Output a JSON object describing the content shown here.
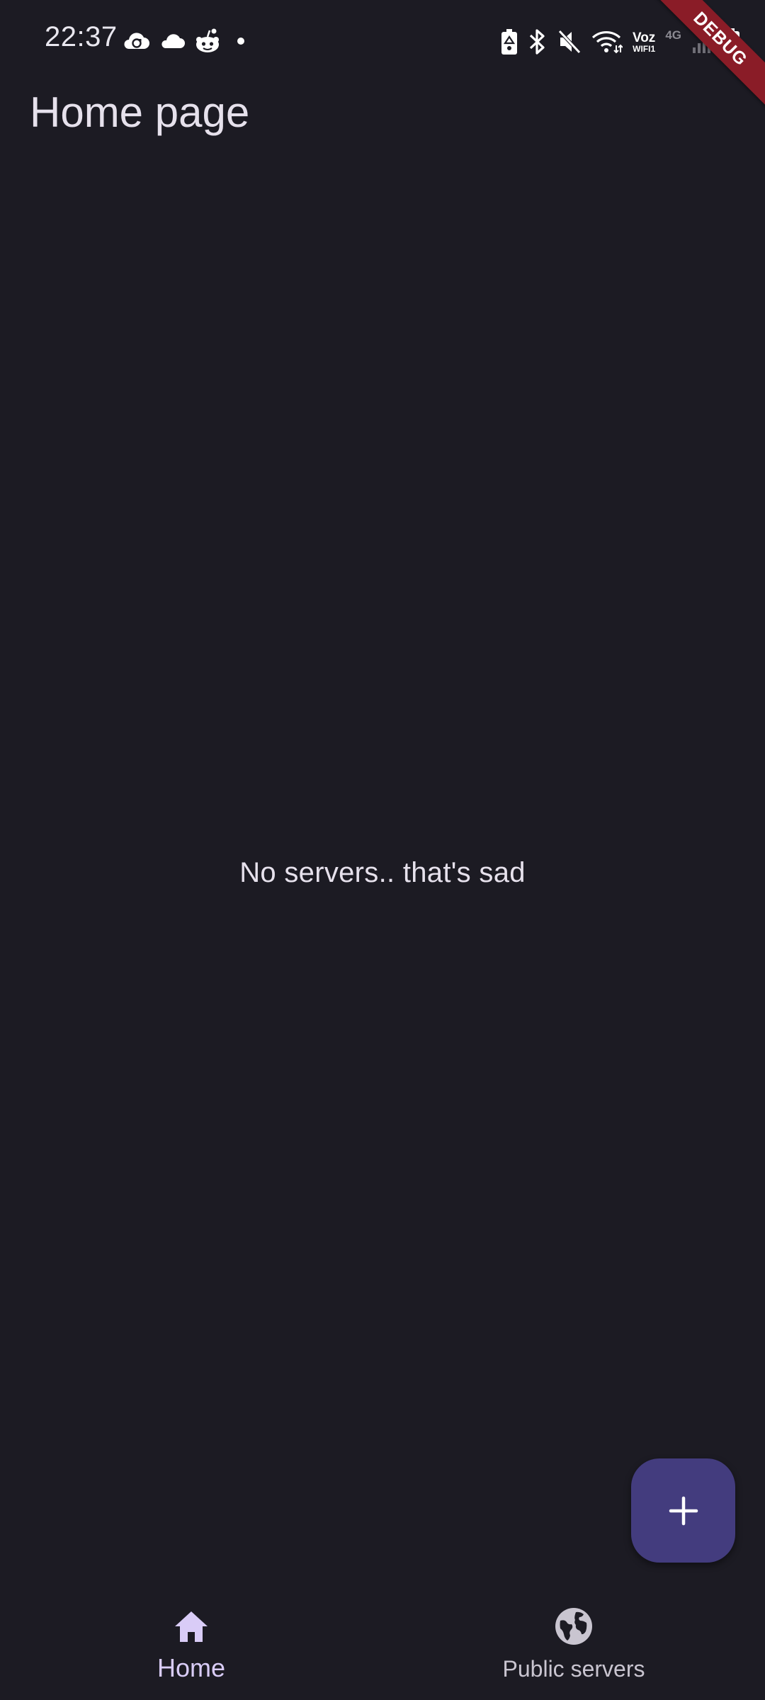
{
  "status_bar": {
    "time": "22:37",
    "left_icons": [
      "cloud-sync-icon",
      "cloud-icon",
      "reddit-icon",
      "dot-icon"
    ],
    "right_icons": [
      "battery-saver-icon",
      "bluetooth-icon",
      "mute-icon",
      "wifi-icon",
      "volte-icon",
      "mobile-signal-icon",
      "battery-icon"
    ],
    "volte_line1": "Voz",
    "volte_line2": "WIFI1",
    "network_type": "4G"
  },
  "debug_banner": "DEBUG",
  "app_bar": {
    "title": "Home page"
  },
  "main": {
    "empty_message": "No servers.. that's sad"
  },
  "fab": {
    "icon": "plus-icon"
  },
  "bottom_nav": {
    "items": [
      {
        "label": "Home",
        "icon": "home-icon",
        "selected": true
      },
      {
        "label": "Public servers",
        "icon": "globe-icon",
        "selected": false
      }
    ]
  },
  "colors": {
    "background": "#1c1b23",
    "fab": "#433c7e",
    "nav_selected": "#d9ccf7",
    "debug_banner": "#8a1c27"
  }
}
